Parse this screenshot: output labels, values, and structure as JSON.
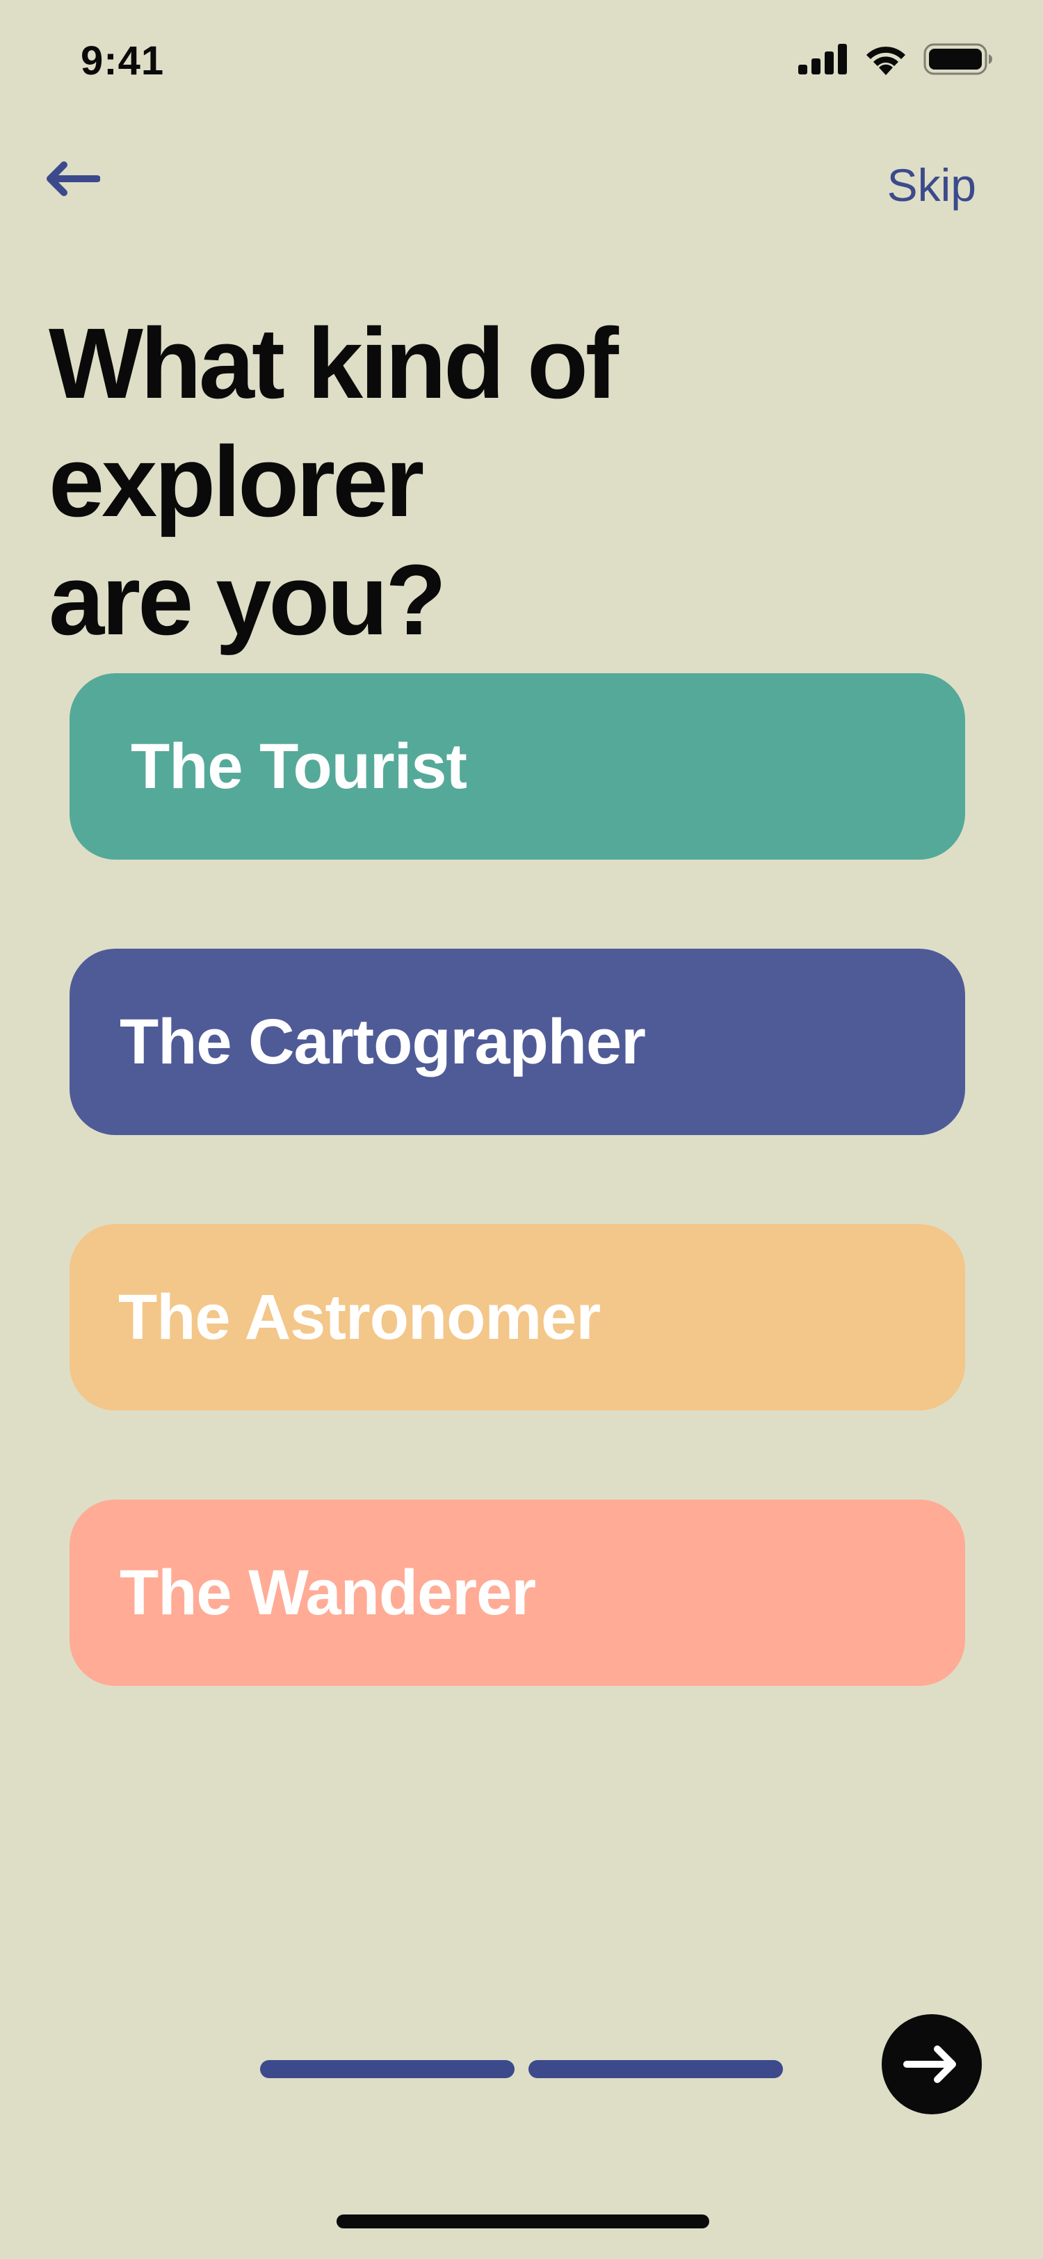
{
  "status_bar": {
    "time": "9:41",
    "icons": [
      "cellular-signal-icon",
      "wifi-icon",
      "battery-icon"
    ]
  },
  "nav": {
    "back_icon": "arrow-left-icon",
    "skip_label": "Skip"
  },
  "title": {
    "line1": "What kind of explorer",
    "line2": "are you?"
  },
  "options": [
    {
      "label": "The Tourist",
      "color": "#55A999"
    },
    {
      "label": "The Cartographer",
      "color": "#4F5B97"
    },
    {
      "label": "The Astronomer",
      "color": "#F3C689"
    },
    {
      "label": "The Wanderer",
      "color": "#FFAB95"
    }
  ],
  "progress": {
    "segments": 2,
    "completed": 2
  },
  "next_button": {
    "icon": "arrow-right-icon"
  },
  "colors": {
    "background": "#DEDEC7",
    "accent": "#3C4A8C",
    "text": "#0A0A0A"
  }
}
